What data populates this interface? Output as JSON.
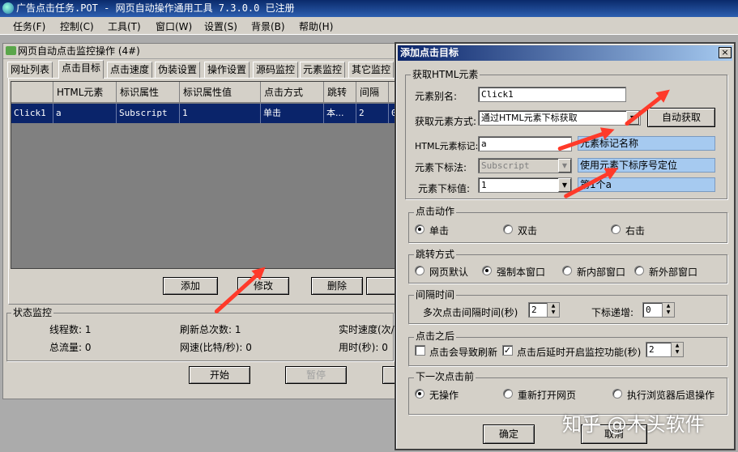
{
  "app": {
    "title": "广告点击任务.POT  - 网页自动操作通用工具 7.3.0.0  已注册",
    "menu": [
      "任务(F)",
      "控制(C)",
      "工具(T)",
      "窗口(W)",
      "设置(S)",
      "背景(B)",
      "帮助(H)"
    ]
  },
  "child_window": {
    "title": "网页自动点击监控操作  (4#)",
    "tabs": [
      "网址列表",
      "点击目标",
      "点击速度",
      "伪装设置",
      "操作设置",
      "源码监控",
      "元素监控",
      "其它监控"
    ],
    "active_tab": "点击目标",
    "grid": {
      "columns": [
        "HTML元素",
        "标识属性",
        "标识属性值",
        "点击方式",
        "跳转",
        "间隔"
      ],
      "rows": [
        {
          "name": "Click1",
          "cells": [
            "a",
            "Subscript",
            "1",
            "单击",
            "本...",
            "2",
            "0"
          ]
        }
      ]
    },
    "buttons": {
      "add": "添加",
      "edit": "修改",
      "delete": "删除",
      "start": "开始",
      "pause": "暂停"
    },
    "status": {
      "title": "状态监控",
      "threads": "线程数: 1",
      "refresh_total": "刷新总次数: 1",
      "speed": "实时速度(次/",
      "traffic": "总流量: 0",
      "net_speed": "网速(比特/秒): 0",
      "time_used": "用时(秒): 0"
    }
  },
  "dialog": {
    "title": "添加点击目标",
    "close": "×",
    "group_html": {
      "title": "获取HTML元素",
      "alias_label": "元素别名:",
      "alias_value": "Click1",
      "method_label": "获取元素方式:",
      "method_value": "通过HTML元素下标获取",
      "auto_button": "自动获取",
      "tag_label": "HTML元素标记:",
      "tag_value": "a",
      "tag_hint": "元素标记名称",
      "sub_method_label": "元素下标法:",
      "sub_method_value": "Subscript",
      "sub_method_hint": "使用元素下标序号定位",
      "sub_value_label": "元素下标值:",
      "sub_value": "1",
      "sub_value_hint": "第1个a"
    },
    "group_action": {
      "title": "点击动作",
      "options": [
        "单击",
        "双击",
        "右击"
      ],
      "selected": 0
    },
    "group_jump": {
      "title": "跳转方式",
      "options": [
        "网页默认",
        "强制本窗口",
        "新内部窗口",
        "新外部窗口"
      ],
      "selected": 1
    },
    "group_interval": {
      "title": "间隔时间",
      "multi_label": "多次点击间隔时间(秒)",
      "multi_value": "2",
      "inc_label": "下标递增:",
      "inc_value": "0"
    },
    "group_after": {
      "title": "点击之后",
      "refresh_label": "点击会导致刷新",
      "refresh_checked": false,
      "delay_label": "点击后延时开启监控功能(秒)",
      "delay_checked": true,
      "delay_value": "2"
    },
    "group_next": {
      "title": "下一次点击前",
      "options": [
        "无操作",
        "重新打开网页",
        "执行浏览器后退操作"
      ],
      "selected": 0
    },
    "ok": "确定",
    "cancel": "取消"
  },
  "watermark": "知乎 @木头软件",
  "colors": {
    "selection": "#0a246a",
    "hint_bg": "#a6caf0",
    "arrow": "#ff3a2a",
    "window_bg": "#d4d0c8"
  }
}
